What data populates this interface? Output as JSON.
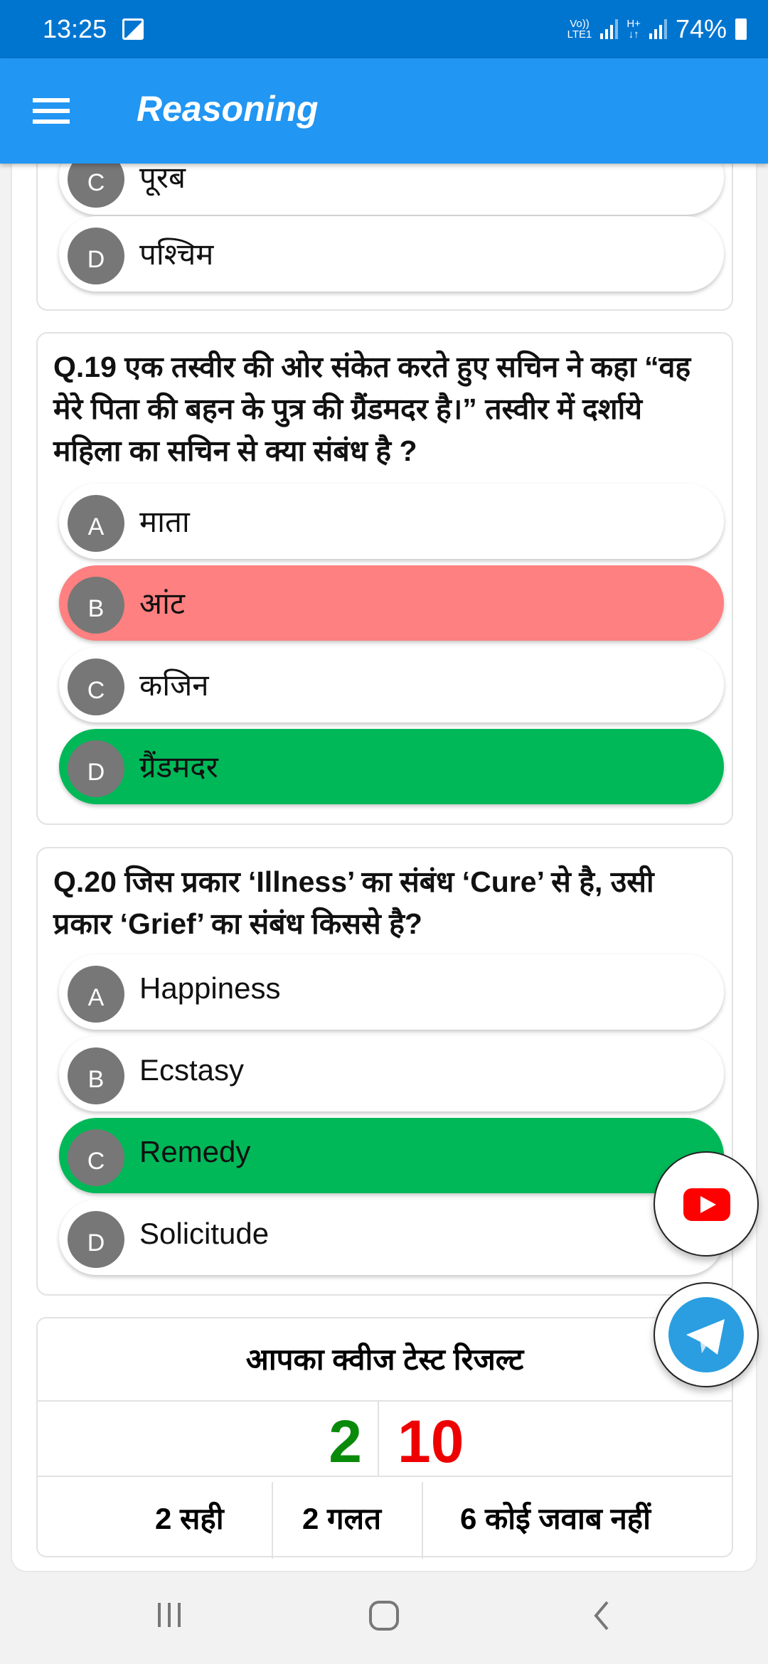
{
  "status_bar": {
    "time": "13:25",
    "net1_top": "Vo))",
    "net1_bottom": "LTE1",
    "net2_top": "H+",
    "net2_bottom": "↓↑",
    "battery": "74%"
  },
  "app_bar": {
    "title": "Reasoning",
    "menu_icon": "hamburger-icon"
  },
  "prev_question": {
    "options": [
      {
        "letter": "C",
        "text": "पूरब",
        "state": "normal"
      },
      {
        "letter": "D",
        "text": "पश्चिम",
        "state": "normal"
      }
    ]
  },
  "questions": [
    {
      "text": "Q.19 एक तस्वीर की ओर संकेत करते हुए सचिन ने कहा “वह मेरे पिता की बहन के पुत्र की ग्रैंडमदर है।” तस्वीर में दर्शाये महिला का सचिन से क्या संबंध है ?",
      "options": [
        {
          "letter": "A",
          "text": "माता",
          "state": "normal"
        },
        {
          "letter": "B",
          "text": "आंट",
          "state": "wrong"
        },
        {
          "letter": "C",
          "text": "कजिन",
          "state": "normal"
        },
        {
          "letter": "D",
          "text": "ग्रैंडमदर",
          "state": "correct"
        }
      ]
    },
    {
      "text": "Q.20 जिस प्रकार ‘Illness’ का संबंध ‘Cure’ से है, उसी प्रकार ‘Grief’ का संबंध किससे है?",
      "options": [
        {
          "letter": "A",
          "text": "Happiness",
          "state": "normal"
        },
        {
          "letter": "B",
          "text": "Ecstasy",
          "state": "normal"
        },
        {
          "letter": "C",
          "text": "Remedy",
          "state": "correct"
        },
        {
          "letter": "D",
          "text": "Solicitude",
          "state": "normal"
        }
      ]
    }
  ],
  "result": {
    "title": "आपका क्वीज टेस्ट रिजल्ट",
    "score": "2",
    "total": "10",
    "correct": "2 सही",
    "wrong": "2 गलत",
    "unanswered": "6 कोई जवाब नहीं"
  },
  "colors": {
    "status_bar": "#0075d0",
    "app_bar": "#2196f3",
    "wrong": "#ff8080",
    "correct": "#00b858",
    "score": "#0a8a0a",
    "total": "#ee0000"
  }
}
